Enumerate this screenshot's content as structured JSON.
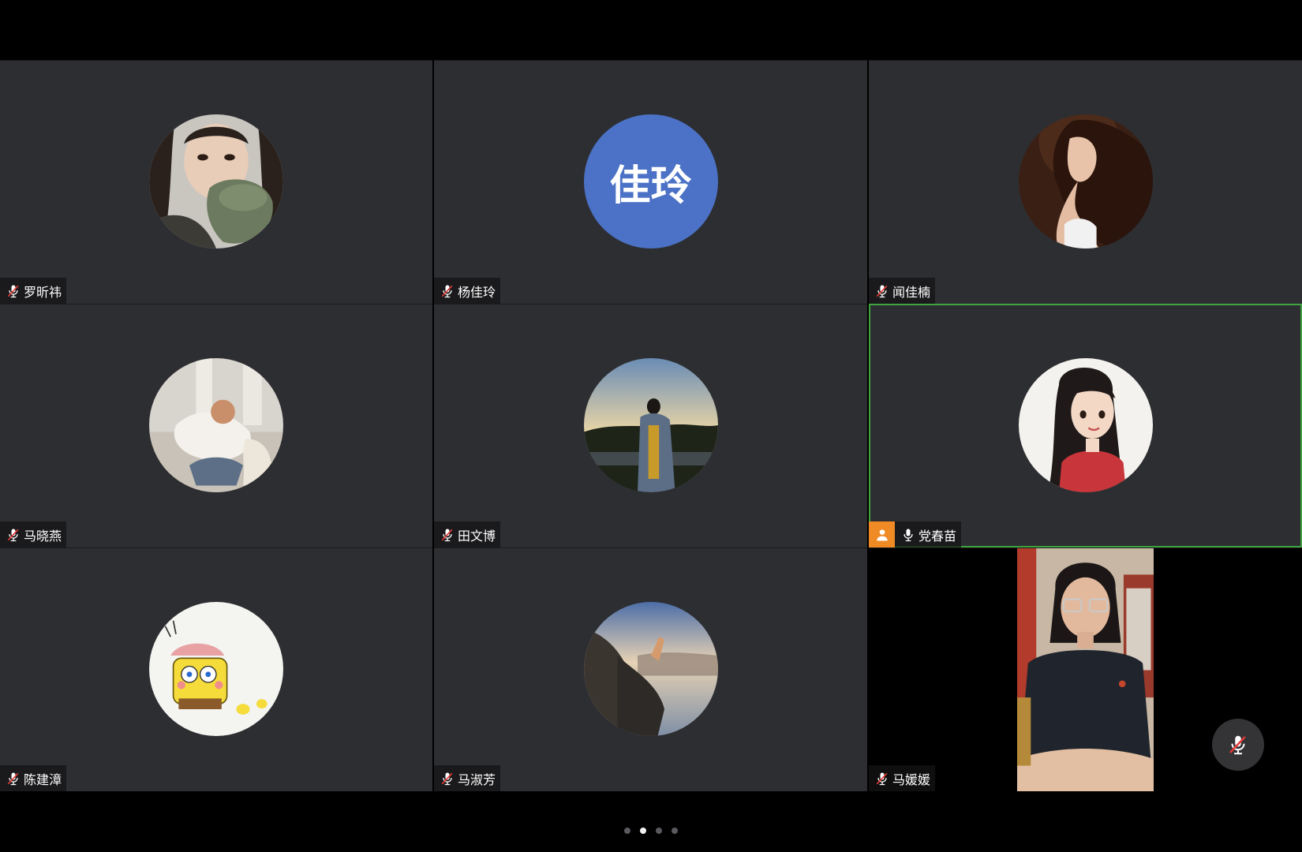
{
  "window": {
    "page_indicator": {
      "count": 4,
      "active_index": 1
    }
  },
  "participants": [
    {
      "name": "罗昕祎",
      "muted": true,
      "avatar": "photo-girl-mask"
    },
    {
      "name": "杨佳玲",
      "muted": true,
      "avatar_initials": "佳玲",
      "avatar_color": "#4b72c6"
    },
    {
      "name": "闻佳楠",
      "muted": true,
      "avatar": "photo-portrait"
    },
    {
      "name": "马晓燕",
      "muted": true,
      "avatar": "photo-bedroom"
    },
    {
      "name": "田文博",
      "muted": true,
      "avatar": "photo-sunset-man"
    },
    {
      "name": "党春苗",
      "muted": false,
      "host": true,
      "speaking": true,
      "avatar": "illustration-girl"
    },
    {
      "name": "陈建漳",
      "muted": true,
      "avatar": "sponge-cartoon"
    },
    {
      "name": "马淑芳",
      "muted": true,
      "avatar": "photo-window-sky"
    },
    {
      "name": "马媛媛",
      "muted": true,
      "video_on": true
    }
  ],
  "colors": {
    "tile_bg": "#2d2e32",
    "active_border": "#3fa33f",
    "host_badge": "#f08a24"
  }
}
